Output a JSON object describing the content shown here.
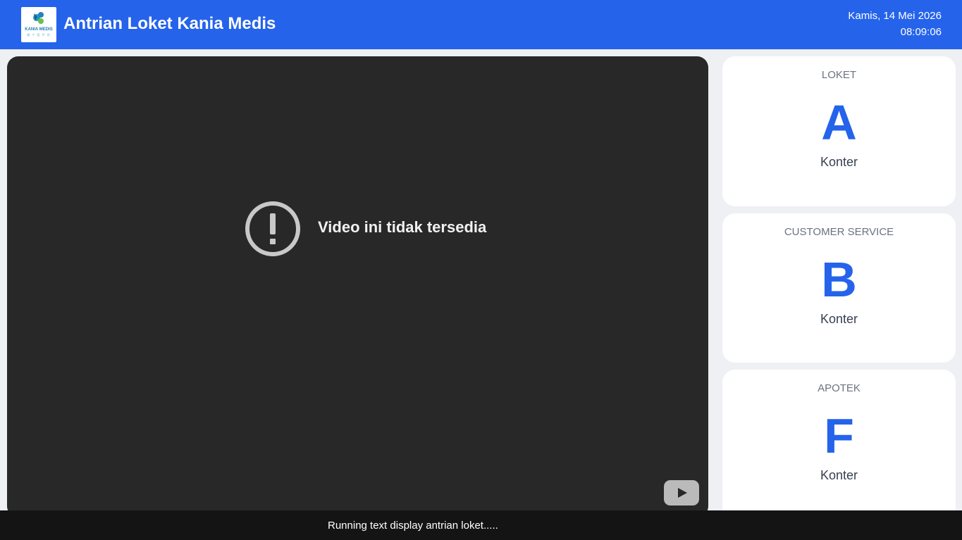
{
  "header": {
    "logo_text": "KANIA MEDIS",
    "logo_sub": "康 宁 医 疗 所",
    "title": "Antrian Loket Kania Medis",
    "date": "Kamis, 14 Mei 2026",
    "time": "08:09:06",
    "background_color": "#2563eb"
  },
  "video": {
    "message": "Video ini tidak tersedia",
    "status_icon": "alert-circle-icon",
    "player_icon": "youtube-icon"
  },
  "counters": [
    {
      "label": "LOKET",
      "letter": "A",
      "sub": "Konter"
    },
    {
      "label": "CUSTOMER SERVICE",
      "letter": "B",
      "sub": "Konter"
    },
    {
      "label": "APOTEK",
      "letter": "F",
      "sub": "Konter"
    }
  ],
  "ticker": {
    "text": "Running text display antrian loket....."
  },
  "colors": {
    "accent": "#2563eb",
    "video_bg": "#282828",
    "ticker_bg": "#141414"
  }
}
